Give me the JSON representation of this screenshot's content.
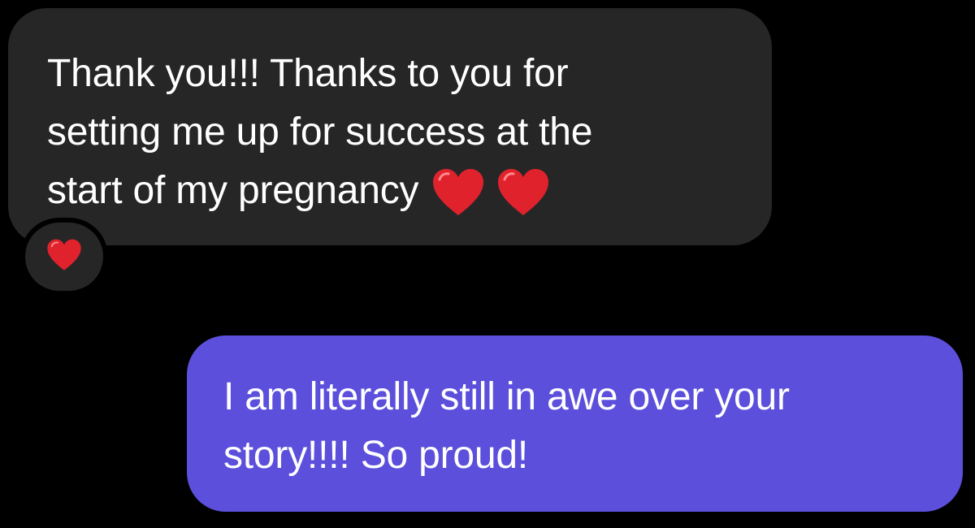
{
  "colors": {
    "background": "#000000",
    "incoming_bubble": "#262626",
    "outgoing_bubble": "#5b4fdb",
    "text": "#ffffff",
    "heart": "#e0222d"
  },
  "conversation": {
    "incoming": {
      "lines": [
        "Thank you!!! Thanks to you for",
        "setting me up for success at the",
        "start of my pregnancy"
      ],
      "emoji": [
        "red-heart-icon",
        "red-heart-icon"
      ],
      "reaction": "red-heart-icon"
    },
    "outgoing": {
      "lines": [
        "I am literally still in awe over your",
        "story!!!! So proud!"
      ]
    }
  }
}
